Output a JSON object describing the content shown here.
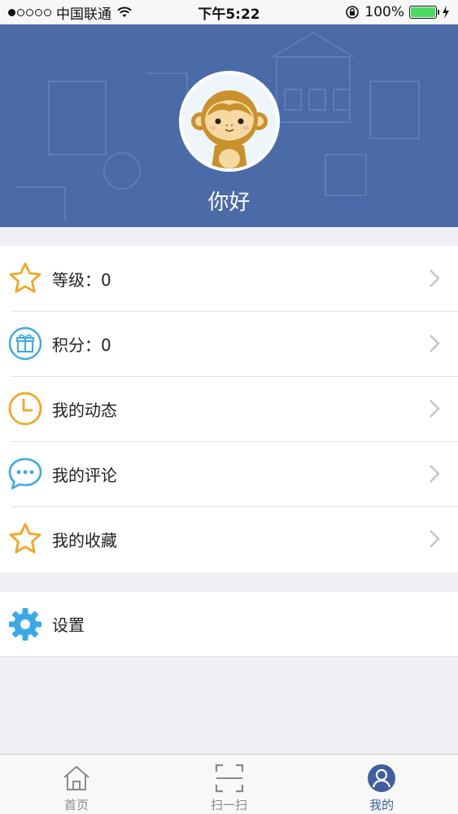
{
  "status_bar": {
    "carrier": "中国联通",
    "time": "下午5:22",
    "battery": "100%",
    "battery_level": 1.0
  },
  "header": {
    "greeting": "你好",
    "background_color": "#4a6aa8",
    "avatar_icon": "monkey-avatar"
  },
  "menu": {
    "items": [
      {
        "label": "等级：0",
        "icon": "star-icon",
        "color": "#f5a623"
      },
      {
        "label": "积分：0",
        "icon": "gift-icon",
        "color": "#3aa9e8"
      },
      {
        "label": "我的动态",
        "icon": "clock-icon",
        "color": "#f5a623"
      },
      {
        "label": "我的评论",
        "icon": "chat-bubble-icon",
        "color": "#3aa9e8"
      },
      {
        "label": "我的收藏",
        "icon": "star-icon",
        "color": "#f5a623"
      }
    ]
  },
  "settings": {
    "label": "设置",
    "icon": "gear-icon",
    "color": "#3aa9e8"
  },
  "tab_bar": {
    "tabs": [
      {
        "label": "首页",
        "icon": "home-icon",
        "active": false
      },
      {
        "label": "扫一扫",
        "icon": "scan-icon",
        "active": false
      },
      {
        "label": "我的",
        "icon": "user-icon",
        "active": true
      }
    ],
    "active_color": "#3f5f9f"
  }
}
